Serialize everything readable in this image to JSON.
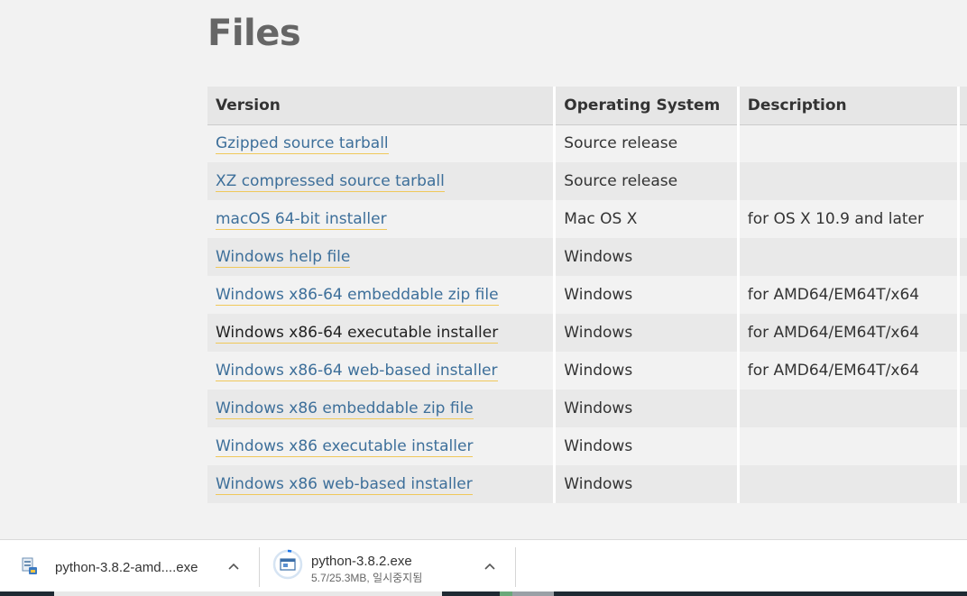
{
  "page": {
    "title": "Files"
  },
  "table": {
    "headers": [
      "Version",
      "Operating System",
      "Description"
    ],
    "rows": [
      {
        "version": "Gzipped source tarball",
        "os": "Source release",
        "description": ""
      },
      {
        "version": "XZ compressed source tarball",
        "os": "Source release",
        "description": ""
      },
      {
        "version": "macOS 64-bit installer",
        "os": "Mac OS X",
        "description": "for OS X 10.9 and later"
      },
      {
        "version": "Windows help file",
        "os": "Windows",
        "description": ""
      },
      {
        "version": "Windows x86-64 embeddable zip file",
        "os": "Windows",
        "description": "for AMD64/EM64T/x64"
      },
      {
        "version": "Windows x86-64 executable installer",
        "os": "Windows",
        "description": "for AMD64/EM64T/x64"
      },
      {
        "version": "Windows x86-64 web-based installer",
        "os": "Windows",
        "description": "for AMD64/EM64T/x64"
      },
      {
        "version": "Windows x86 embeddable zip file",
        "os": "Windows",
        "description": ""
      },
      {
        "version": "Windows x86 executable installer",
        "os": "Windows",
        "description": ""
      },
      {
        "version": "Windows x86 web-based installer",
        "os": "Windows",
        "description": ""
      }
    ]
  },
  "downloads": [
    {
      "name": "python-3.8.2-amd....exe",
      "icon": "installer-icon",
      "status": ""
    },
    {
      "name": "python-3.8.2.exe",
      "icon": "in-progress-file-icon",
      "status": "5.7/25.3MB, 일시중지됨"
    }
  ],
  "colors": {
    "link": "#3d6f9a",
    "link_underline": "#f0c85a",
    "header_bg": "#e6e6e6",
    "page_bg": "#f2f2f2"
  }
}
